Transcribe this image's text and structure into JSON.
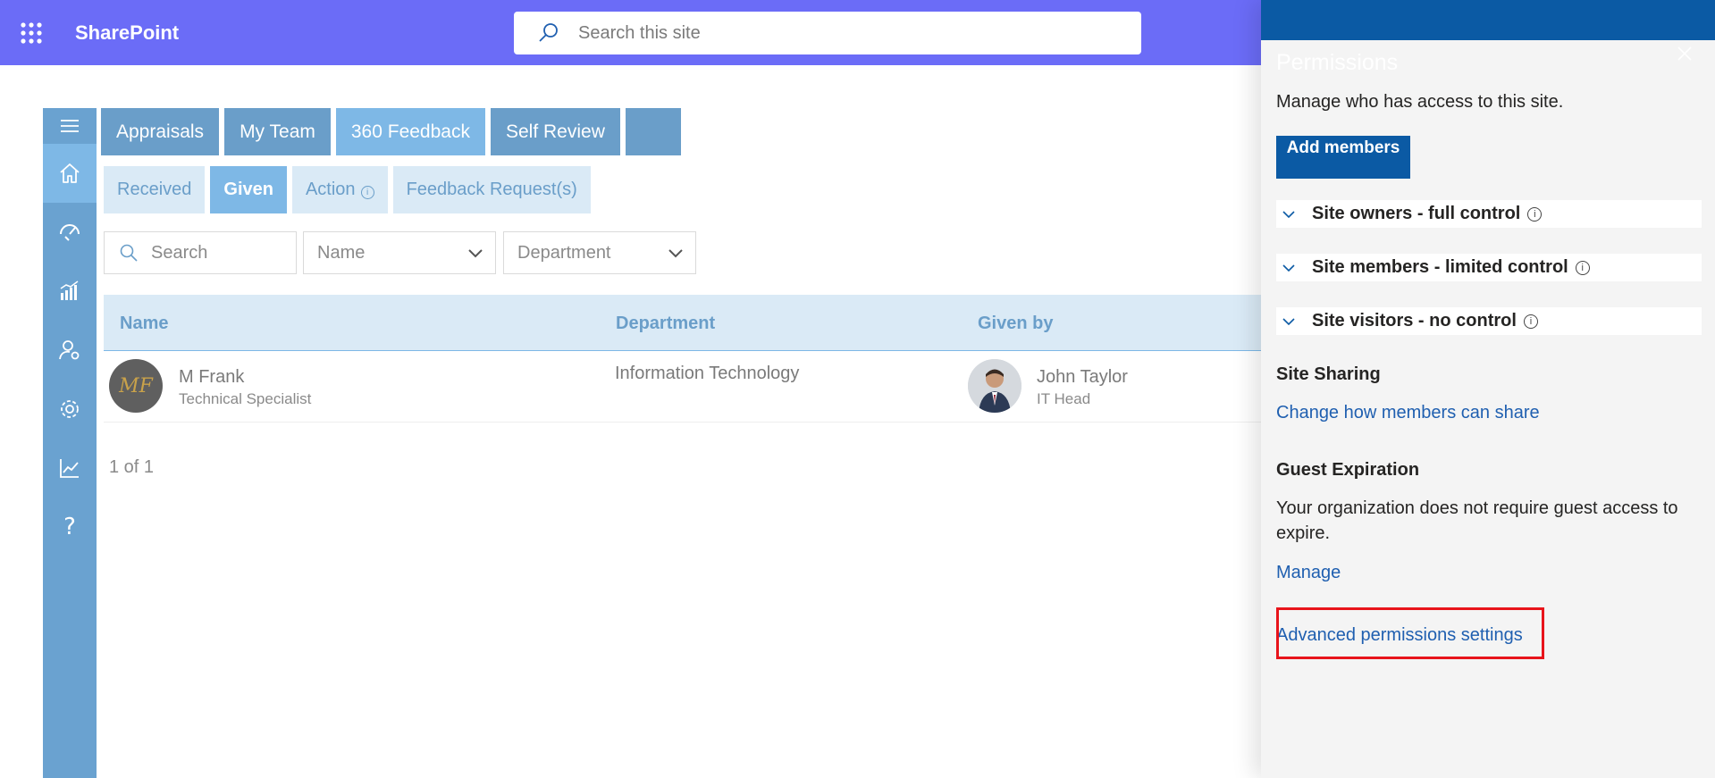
{
  "suite": {
    "brand": "SharePoint",
    "search_placeholder": "Search this site",
    "bar_color": "#6b6cf7"
  },
  "rail": {
    "items": [
      {
        "icon": "menu-icon"
      },
      {
        "icon": "home-icon",
        "active": true
      },
      {
        "icon": "gauge-icon"
      },
      {
        "icon": "bar-chart-icon"
      },
      {
        "icon": "user-gear-icon"
      },
      {
        "icon": "settings-icon"
      },
      {
        "icon": "line-chart-icon"
      },
      {
        "icon": "help-icon",
        "glyph": "?"
      }
    ]
  },
  "tabs": [
    {
      "label": "Appraisals"
    },
    {
      "label": "My Team"
    },
    {
      "label": "360 Feedback",
      "active": true
    },
    {
      "label": "Self Review"
    },
    {
      "label": ""
    }
  ],
  "subtabs": [
    {
      "label": "Received"
    },
    {
      "label": "Given",
      "active": true
    },
    {
      "label": "Action",
      "info": "i"
    },
    {
      "label": "Feedback Request(s)"
    }
  ],
  "filters": {
    "search_placeholder": "Search",
    "name_select": "Name",
    "department_select": "Department"
  },
  "table": {
    "headers": {
      "name": "Name",
      "department": "Department",
      "given_by": "Given by"
    },
    "rows": [
      {
        "name": "M Frank",
        "role": "Technical Specialist",
        "department": "Information Technology",
        "given_by_name": "John Taylor",
        "given_by_role": "IT Head",
        "avatar_initials": "MF"
      }
    ],
    "pager": "1 of 1"
  },
  "panel": {
    "title": "Permissions",
    "description": "Manage who has access to this site.",
    "add_members": "Add members",
    "groups": [
      {
        "label": "Site owners - full control",
        "info": "i"
      },
      {
        "label": "Site members - limited control",
        "info": "i"
      },
      {
        "label": "Site visitors - no control",
        "info": "i"
      }
    ],
    "site_sharing": {
      "heading": "Site Sharing",
      "link": "Change how members can share"
    },
    "guest_expiration": {
      "heading": "Guest Expiration",
      "text": "Your organization does not require guest access to expire.",
      "link": "Manage"
    },
    "advanced_link": "Advanced permissions settings",
    "accent": "#0b5aa4",
    "highlight_color": "#e8141b"
  }
}
